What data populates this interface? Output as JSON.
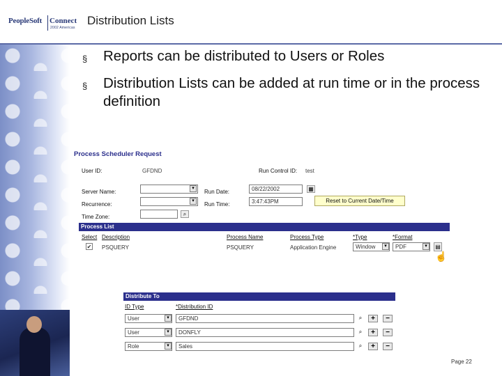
{
  "header": {
    "logo_text": "PeopleSoft",
    "logo_connect": "Connect",
    "logo_tag": "2002 Americas",
    "title": "Distribution Lists"
  },
  "bullets": [
    "Reports can be distributed to Users or Roles",
    "Distribution Lists can be added at run time or in the process definition"
  ],
  "bullet_glyph": "§",
  "psr": {
    "title": "Process Scheduler Request",
    "user_id_label": "User ID:",
    "user_id_value": "GFDND",
    "run_control_label": "Run Control ID:",
    "run_control_value": "test",
    "server_name_label": "Server Name:",
    "run_date_label": "Run Date:",
    "run_date_value": "08/22/2002",
    "recurrence_label": "Recurrence:",
    "run_time_label": "Run Time:",
    "run_time_value": "3:47:43PM",
    "reset_button": "Reset to Current Date/Time",
    "time_zone_label": "Time Zone:",
    "process_list_header": "Process List",
    "columns": [
      "Select",
      "Description",
      "Process Name",
      "Process Type",
      "*Type",
      "*Format"
    ],
    "row": {
      "select": "✔",
      "description": "PSQUERY",
      "process_name": "PSQUERY",
      "process_type": "Application Engine",
      "type": "Window",
      "format": "PDF"
    }
  },
  "distribute": {
    "header": "Distribute To",
    "col_id_type": "ID Type",
    "col_dist_id": "*Distribution ID",
    "rows": [
      {
        "id_type": "User",
        "dist_id": "GFDND"
      },
      {
        "id_type": "User",
        "dist_id": "DONFLY"
      },
      {
        "id_type": "Role",
        "dist_id": "Sales"
      }
    ],
    "plus": "+",
    "minus": "−"
  },
  "footer": {
    "page": "Page 22"
  },
  "colors": {
    "accent": "#2b2f8c",
    "highlight": "#ffffcc",
    "band": "#7c8fc7"
  }
}
